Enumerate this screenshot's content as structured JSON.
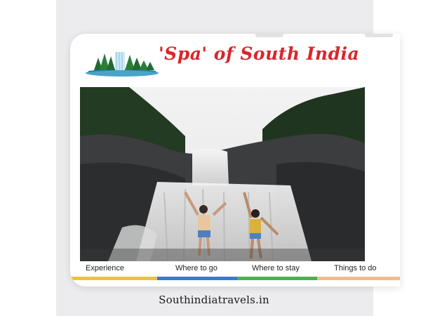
{
  "site": {
    "title": "'Spa' of South India"
  },
  "nav": {
    "items": [
      {
        "label": "Experience",
        "color": "#f0c23b"
      },
      {
        "label": "Where to go",
        "color": "#3a78d6"
      },
      {
        "label": "Where to stay",
        "color": "#4caf50"
      },
      {
        "label": "Things to do",
        "color": "#f3b98e"
      }
    ]
  },
  "footer": {
    "domain": "Southindiatravels.in"
  },
  "colors": {
    "title_red": "#d9262b",
    "backdrop": "#ececee"
  }
}
